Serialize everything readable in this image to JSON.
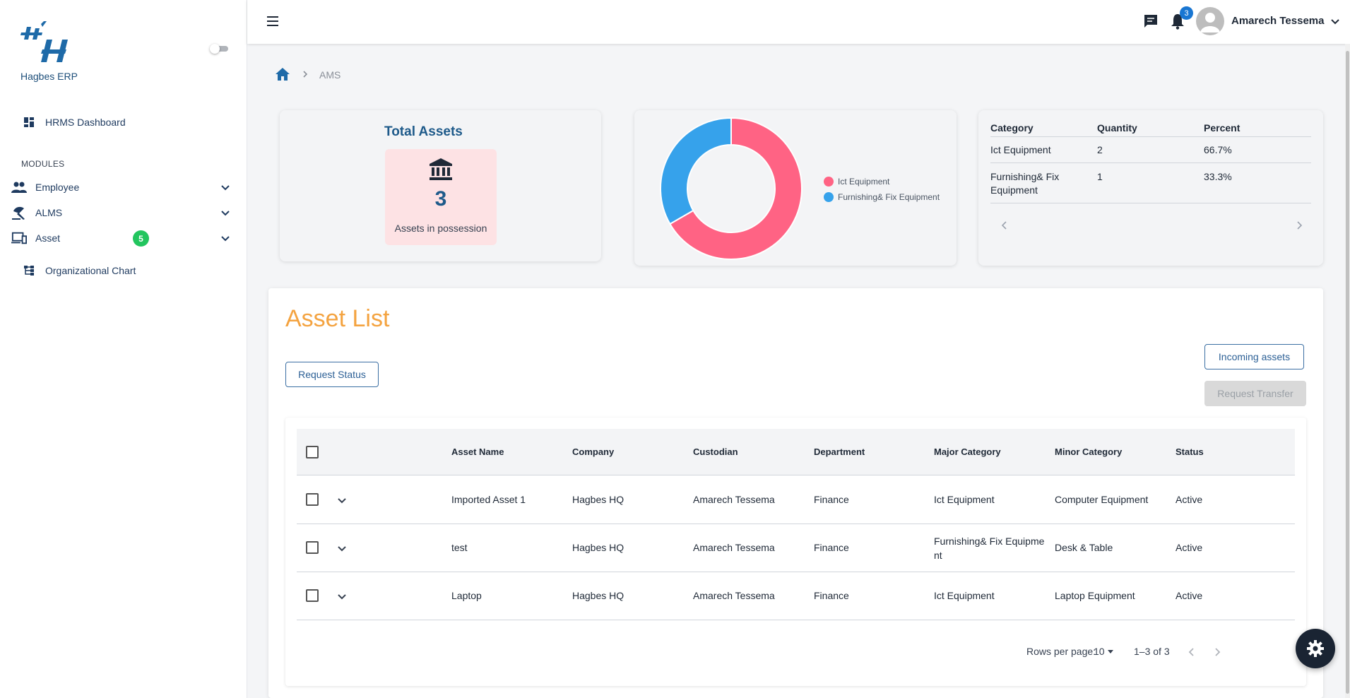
{
  "app": {
    "brand": "Hagbes ERP"
  },
  "sidebar": {
    "dashboard_label": "HRMS Dashboard",
    "modules_label": "MODULES",
    "items": [
      {
        "label": "Employee",
        "icon": "people-icon"
      },
      {
        "label": "ALMS",
        "icon": "beach-umbrella-icon"
      },
      {
        "label": "Asset",
        "icon": "devices-icon",
        "badge": "5"
      }
    ],
    "org_chart_label": "Organizational Chart"
  },
  "topbar": {
    "notification_count": "3",
    "user_name": "Amarech Tessema"
  },
  "breadcrumb": {
    "current": "AMS"
  },
  "summary": {
    "title": "Total Assets",
    "total": "3",
    "total_label": "Assets in possession"
  },
  "chart_data": {
    "type": "pie",
    "donut": true,
    "categories": [
      "Ict Equipment",
      "Furnishing& Fix Equipment"
    ],
    "values": [
      2,
      1
    ],
    "colors": [
      "#ff6384",
      "#36a2eb"
    ],
    "legend": "right"
  },
  "category_table": {
    "headers": [
      "Category",
      "Quantity",
      "Percent"
    ],
    "rows": [
      [
        "Ict Equipment",
        "2",
        "66.7%"
      ],
      [
        "Furnishing& Fix Equipment",
        "1",
        "33.3%"
      ]
    ]
  },
  "asset_list": {
    "title": "Asset List",
    "request_status_label": "Request Status",
    "incoming_label": "Incoming assets",
    "transfer_label": "Request Transfer",
    "headers": [
      "Asset Name",
      "Company",
      "Custodian",
      "Department",
      "Major Category",
      "Minor Category",
      "Status"
    ],
    "rows": [
      [
        "Imported Asset 1",
        "Hagbes HQ",
        "Amarech Tessema",
        "Finance",
        "Ict Equipment",
        "Computer Equipment",
        "Active"
      ],
      [
        "test",
        "Hagbes HQ",
        "Amarech Tessema",
        "Finance",
        "Furnishing& Fix Equipment",
        "Desk & Table",
        "Active"
      ],
      [
        "Laptop",
        "Hagbes HQ",
        "Amarech Tessema",
        "Finance",
        "Ict Equipment",
        "Laptop Equipment",
        "Active"
      ]
    ],
    "pager": {
      "rows_label": "Rows per page:",
      "rows_value": "10",
      "range": "1–3 of 3"
    }
  }
}
